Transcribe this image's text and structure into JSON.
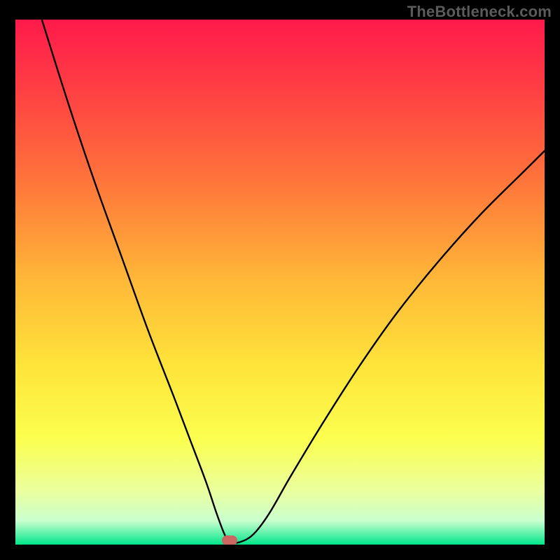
{
  "watermark": "TheBottleneck.com",
  "gradient": {
    "stops": [
      {
        "offset": 0.0,
        "color": "#ff1a4b"
      },
      {
        "offset": 0.12,
        "color": "#ff3b44"
      },
      {
        "offset": 0.3,
        "color": "#ff723b"
      },
      {
        "offset": 0.5,
        "color": "#ffb938"
      },
      {
        "offset": 0.66,
        "color": "#ffe43a"
      },
      {
        "offset": 0.8,
        "color": "#fbff4f"
      },
      {
        "offset": 0.9,
        "color": "#eaffa0"
      },
      {
        "offset": 0.955,
        "color": "#c9ffcf"
      },
      {
        "offset": 1.0,
        "color": "#00e58a"
      }
    ]
  },
  "marker": {
    "x_frac": 0.405,
    "color": "#cb6760"
  },
  "chart_data": {
    "type": "line",
    "title": "",
    "xlabel": "",
    "ylabel": "",
    "xlim": [
      0,
      100
    ],
    "ylim": [
      0,
      100
    ],
    "series": [
      {
        "name": "curve",
        "x": [
          5,
          10,
          15,
          20,
          25,
          30,
          33,
          36,
          38,
          39.5,
          40.5,
          42.5,
          45,
          48,
          52,
          58,
          65,
          72,
          80,
          88,
          96,
          100
        ],
        "values": [
          100,
          84,
          69,
          55,
          41,
          28,
          20,
          12,
          6,
          2,
          0.5,
          0.5,
          2,
          6,
          13,
          23,
          34,
          44,
          54,
          63,
          71,
          75
        ]
      }
    ],
    "annotations": [
      {
        "type": "pill-marker",
        "x": 40.5,
        "y": 0.5,
        "color": "#cb6760"
      }
    ]
  }
}
